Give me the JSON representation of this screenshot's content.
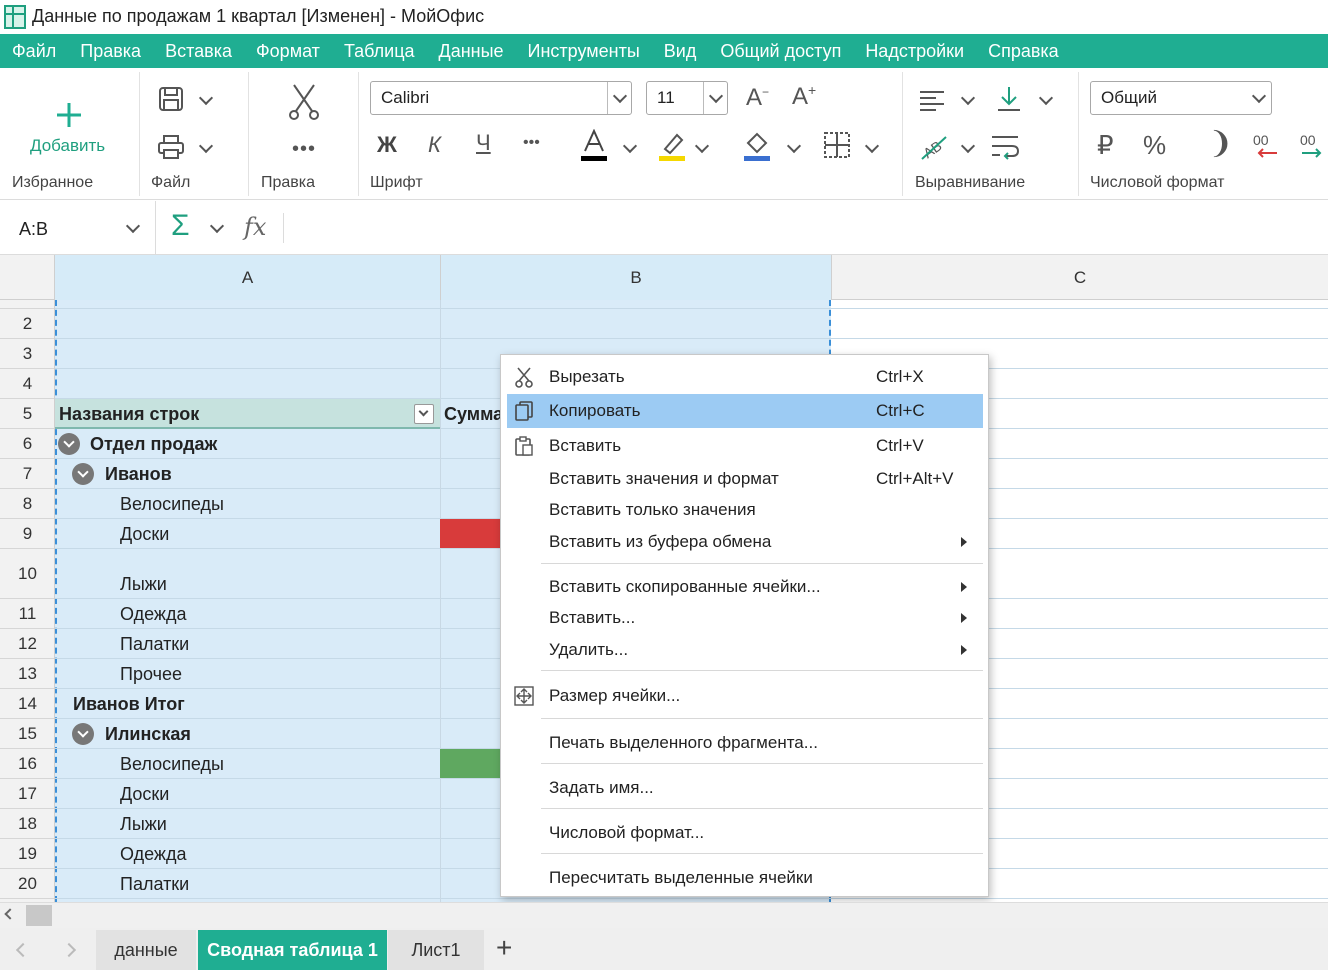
{
  "window": {
    "title": "Данные по продажам 1 квартал [Изменен] - МойОфис"
  },
  "menu": [
    "Файл",
    "Правка",
    "Вставка",
    "Формат",
    "Таблица",
    "Данные",
    "Инструменты",
    "Вид",
    "Общий доступ",
    "Надстройки",
    "Справка"
  ],
  "ribbon": {
    "add_label": "Добавить",
    "groups": {
      "favorites": "Избранное",
      "file": "Файл",
      "edit": "Правка",
      "font": "Шрифт",
      "align": "Выравнивание",
      "number_format": "Числовой формат"
    },
    "font_name": "Calibri",
    "font_size": "11",
    "number_format_value": "Общий",
    "bold_glyph": "Ж",
    "italic_glyph": "К",
    "underline_glyph": "Ч",
    "currency_glyph": "₽",
    "percent_glyph": "%",
    "text_color": "#000000",
    "highlight_color": "#f5d800",
    "fill_color": "#3a6fd0"
  },
  "formula": {
    "name_box": "A:B",
    "sum_glyph": "Σ",
    "fx_glyph": "fx"
  },
  "columns": [
    "A",
    "B",
    "C"
  ],
  "rows": [
    {
      "num": "2",
      "a": "",
      "style": ""
    },
    {
      "num": "3",
      "a": "",
      "style": ""
    },
    {
      "num": "4",
      "a": "",
      "style": ""
    },
    {
      "num": "5",
      "a": "Названия строк",
      "b": "Сумма",
      "style": "header"
    },
    {
      "num": "6",
      "a": "Отдел продаж",
      "style": "lvl0"
    },
    {
      "num": "7",
      "a": "Иванов",
      "style": "lvl1"
    },
    {
      "num": "8",
      "a": "Велосипеды",
      "style": "item"
    },
    {
      "num": "9",
      "a": "Доски",
      "style": "item"
    },
    {
      "num": "10",
      "a": "Лыжи",
      "style": "item"
    },
    {
      "num": "11",
      "a": "Одежда",
      "style": "item"
    },
    {
      "num": "12",
      "a": "Палатки",
      "style": "item"
    },
    {
      "num": "13",
      "a": "Прочее",
      "style": "item"
    },
    {
      "num": "14",
      "a": "Иванов Итог",
      "style": "total"
    },
    {
      "num": "15",
      "a": "Илинская",
      "style": "lvl1"
    },
    {
      "num": "16",
      "a": "Велосипеды",
      "style": "item"
    },
    {
      "num": "17",
      "a": "Доски",
      "style": "item"
    },
    {
      "num": "18",
      "a": "Лыжи",
      "style": "item"
    },
    {
      "num": "19",
      "a": "Одежда",
      "style": "item"
    },
    {
      "num": "20",
      "a": "Палатки",
      "style": "item"
    }
  ],
  "context_menu": [
    {
      "label": "Вырезать",
      "shortcut": "Ctrl+X",
      "icon": "scissors-icon"
    },
    {
      "label": "Копировать",
      "shortcut": "Ctrl+C",
      "icon": "copy-icon",
      "highlighted": true
    },
    {
      "label": "Вставить",
      "shortcut": "Ctrl+V",
      "icon": "paste-icon"
    },
    {
      "label": "Вставить значения и формат",
      "shortcut": "Ctrl+Alt+V"
    },
    {
      "label": "Вставить только значения",
      "shortcut": ""
    },
    {
      "label": "Вставить из буфера обмена",
      "shortcut": "",
      "submenu": true
    },
    {
      "label": "Вставить скопированные ячейки...",
      "submenu": true
    },
    {
      "label": "Вставить...",
      "submenu": true
    },
    {
      "label": "Удалить...",
      "submenu": true
    },
    {
      "label": "Размер ячейки...",
      "icon": "cell-size-icon"
    },
    {
      "label": "Печать выделенного фрагмента..."
    },
    {
      "label": "Задать имя..."
    },
    {
      "label": "Числовой формат..."
    },
    {
      "label": "Пересчитать выделенные ячейки"
    }
  ],
  "sheets": [
    "данные",
    "Сводная таблица 1",
    "Лист1"
  ],
  "colors": {
    "accent": "#1fae92",
    "selection": "#d9ebf8",
    "menu_highlight": "#9ccbf3",
    "red_fill": "#d83b3b",
    "green_fill": "#5fa860"
  }
}
